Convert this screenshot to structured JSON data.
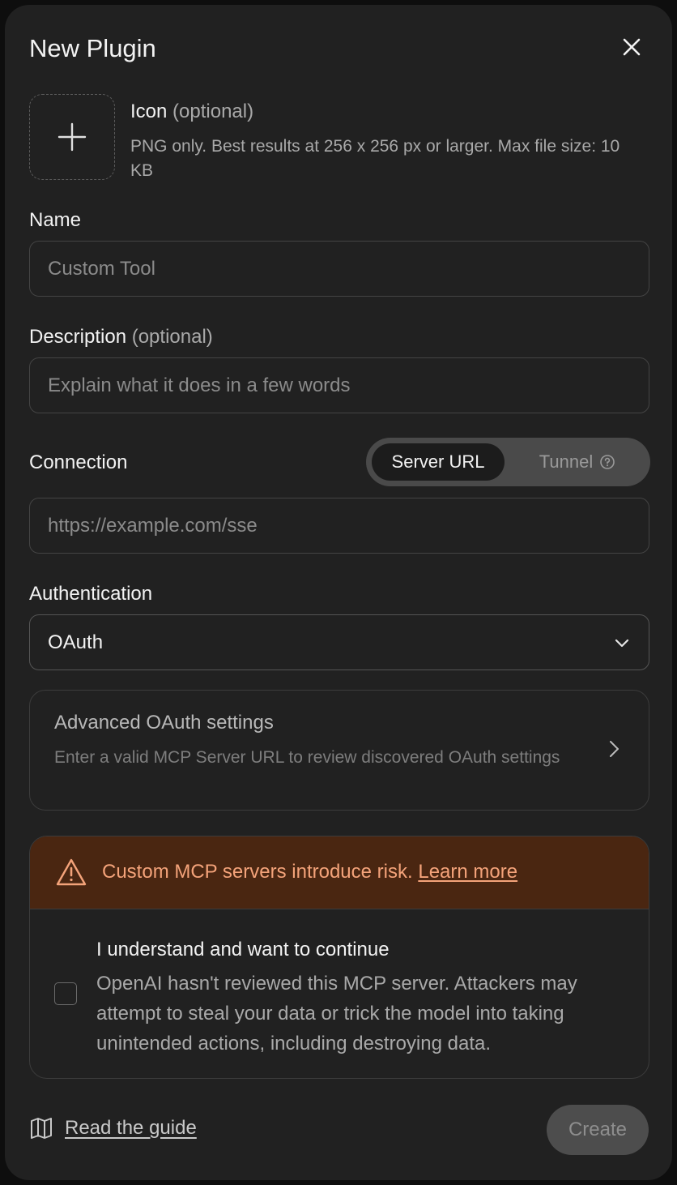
{
  "dialog": {
    "title": "New Plugin",
    "close_icon": "close-icon"
  },
  "icon_upload": {
    "label": "Icon",
    "optional": "(optional)",
    "help": "PNG only. Best results at 256 x 256 px or larger. Max file size: 10 KB",
    "icon": "plus-icon"
  },
  "name": {
    "label": "Name",
    "placeholder": "Custom Tool",
    "value": ""
  },
  "description": {
    "label": "Description",
    "optional": "(optional)",
    "placeholder": "Explain what it does in a few words",
    "value": ""
  },
  "connection": {
    "label": "Connection",
    "options": [
      "Server URL",
      "Tunnel"
    ],
    "selected": "Server URL",
    "tunnel_icon": "help-circle-icon",
    "placeholder": "https://example.com/sse",
    "value": ""
  },
  "authentication": {
    "label": "Authentication",
    "selected": "OAuth",
    "icon": "chevron-down-icon"
  },
  "advanced": {
    "title": "Advanced OAuth settings",
    "description": "Enter a valid MCP Server URL to review discovered OAuth settings",
    "icon": "chevron-right-icon"
  },
  "risk": {
    "warning": "Custom MCP servers introduce risk.",
    "link": "Learn more",
    "icon": "warning-triangle-icon",
    "ack_title": "I understand and want to continue",
    "ack_description": "OpenAI hasn't reviewed this MCP server. Attackers may attempt to steal your data or trick the model into taking unintended actions, including destroying data.",
    "checked": false
  },
  "footer": {
    "guide_label": "Read the guide",
    "guide_icon": "book-icon",
    "create_label": "Create"
  },
  "colors": {
    "background": "#212121",
    "warning_bg": "#4a2611",
    "warning_text": "#f4a37a"
  }
}
